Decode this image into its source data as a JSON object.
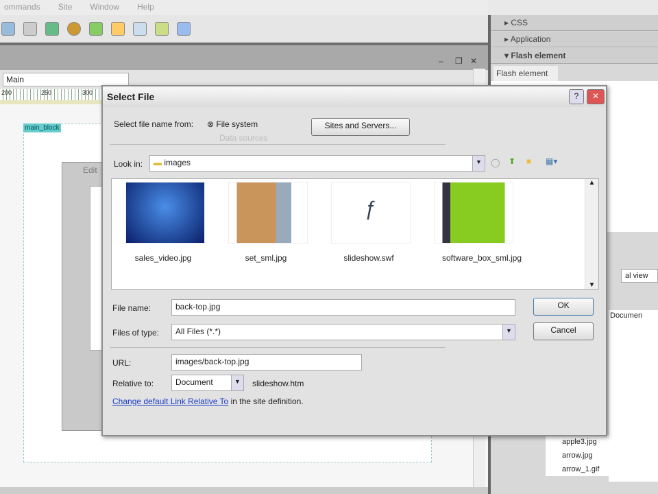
{
  "menu": [
    "ommands",
    "Site",
    "Window",
    "Help"
  ],
  "doc_toolbar": {
    "view_select": "Main"
  },
  "ruler": [
    "200",
    "250",
    "300"
  ],
  "editor": {
    "block_label": "main_block",
    "behind_title": "Edit"
  },
  "right_panel": {
    "css": "CSS",
    "application": "Application",
    "flash_element": "Flash element",
    "tab": "Flash element",
    "view_select": "al view",
    "files_header": "Documen",
    "files": [
      "apple3.jpg",
      "arrow.jpg",
      "arrow_1.gif"
    ]
  },
  "dialog": {
    "title": "Select File",
    "select_from_label": "Select file name from:",
    "option_file_system": "File system",
    "option_data_sources": "Data sources",
    "sites_servers_button": "Sites and Servers...",
    "look_in_label": "Look in:",
    "look_in_value": "images",
    "files": [
      {
        "name": "sales_video.jpg",
        "icon": "image-thumbnail"
      },
      {
        "name": "set_sml.jpg",
        "icon": "image-thumbnail"
      },
      {
        "name": "slideshow.swf",
        "icon": "flash-file-icon"
      },
      {
        "name": "software_box_sml.jpg",
        "icon": "image-thumbnail"
      }
    ],
    "file_name_label": "File name:",
    "file_name_value": "back-top.jpg",
    "files_of_type_label": "Files of type:",
    "files_of_type_value": "All Files (*.*)",
    "ok_button": "OK",
    "cancel_button": "Cancel",
    "url_label": "URL:",
    "url_value": "images/back-top.jpg",
    "relative_to_label": "Relative to:",
    "relative_to_value": "Document",
    "relative_file": "slideshow.htm",
    "change_link": "Change default Link Relative To",
    "change_link_suffix": " in the site definition."
  }
}
